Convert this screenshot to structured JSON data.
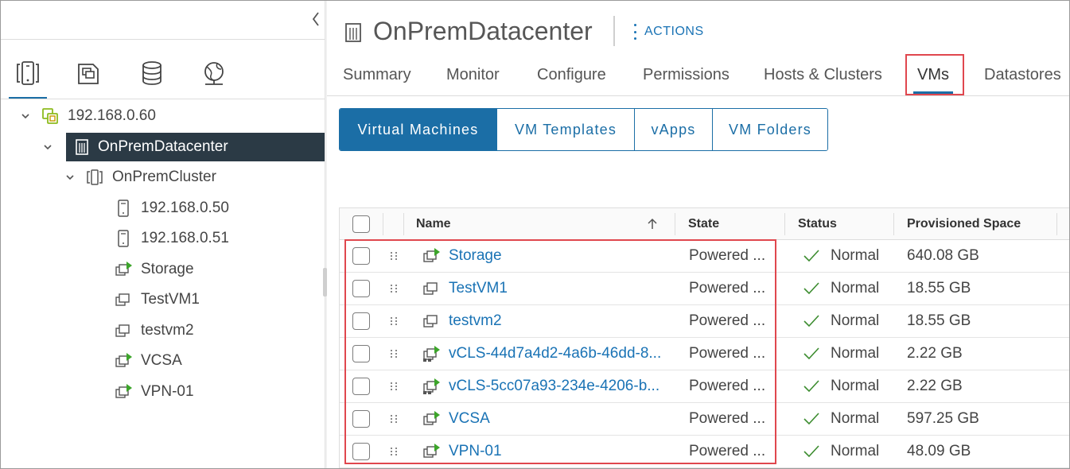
{
  "inventory_tabs": [
    {
      "icon": "hosts-and-clusters-icon"
    },
    {
      "icon": "vms-and-templates-icon"
    },
    {
      "icon": "storage-icon"
    },
    {
      "icon": "networking-icon"
    }
  ],
  "tree": {
    "vcenter": "192.168.0.60",
    "datacenter": "OnPremDatacenter",
    "cluster": "OnPremCluster",
    "hosts": [
      "192.168.0.50",
      "192.168.0.51"
    ],
    "vms": [
      "Storage",
      "TestVM1",
      "testvm2",
      "VCSA",
      "VPN-01"
    ]
  },
  "header": {
    "title": "OnPremDatacenter",
    "actions_label": "ACTIONS"
  },
  "nav_tabs": [
    "Summary",
    "Monitor",
    "Configure",
    "Permissions",
    "Hosts & Clusters",
    "VMs",
    "Datastores"
  ],
  "active_nav_tab": "VMs",
  "sub_tabs": [
    "Virtual Machines",
    "VM Templates",
    "vApps",
    "VM Folders"
  ],
  "active_sub_tab": "Virtual Machines",
  "grid": {
    "columns": [
      "Name",
      "State",
      "Status",
      "Provisioned Space"
    ],
    "rows": [
      {
        "name": "Storage",
        "state": "Powered ...",
        "status": "Normal",
        "space": "640.08 GB",
        "icon": "vm-powered-on-icon"
      },
      {
        "name": "TestVM1",
        "state": "Powered ...",
        "status": "Normal",
        "space": "18.55 GB",
        "icon": "vm-icon"
      },
      {
        "name": "testvm2",
        "state": "Powered ...",
        "status": "Normal",
        "space": "18.55 GB",
        "icon": "vm-icon"
      },
      {
        "name": "vCLS-44d7a4d2-4a6b-46dd-8...",
        "state": "Powered ...",
        "status": "Normal",
        "space": "2.22 GB",
        "icon": "vcls-vm-icon"
      },
      {
        "name": "vCLS-5cc07a93-234e-4206-b...",
        "state": "Powered ...",
        "status": "Normal",
        "space": "2.22 GB",
        "icon": "vcls-vm-icon"
      },
      {
        "name": "VCSA",
        "state": "Powered ...",
        "status": "Normal",
        "space": "597.25 GB",
        "icon": "vm-powered-on-icon"
      },
      {
        "name": "VPN-01",
        "state": "Powered ...",
        "status": "Normal",
        "space": "48.09 GB",
        "icon": "vm-powered-on-icon"
      }
    ]
  },
  "colors": {
    "accent": "#1b6ea6",
    "link": "#1a73b5",
    "selected_bg": "#2b3a45",
    "highlight": "#e0474e",
    "ok_green": "#3c8c2f",
    "poweron_green": "#3ca52a"
  }
}
